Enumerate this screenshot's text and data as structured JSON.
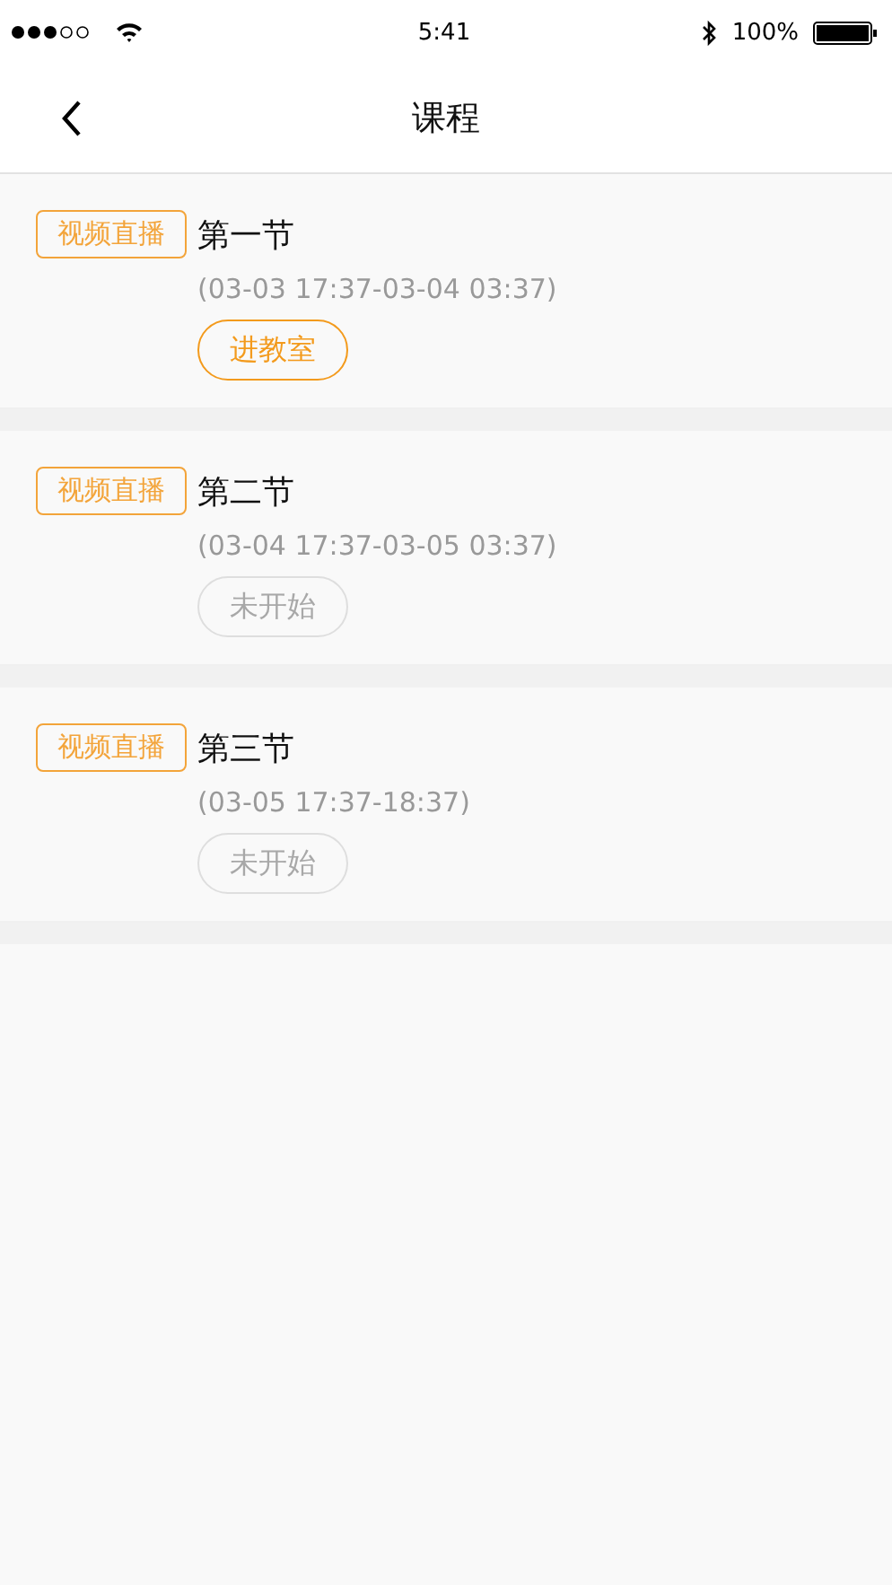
{
  "status_bar": {
    "time": "5:41",
    "battery": "100%"
  },
  "nav_bar": {
    "title": "课程"
  },
  "lessons": [
    {
      "tag": "视频直播",
      "title": "第一节",
      "time": "(03-03 17:37-03-04 03:37)",
      "button": {
        "label": "进教室",
        "disabled": false
      }
    },
    {
      "tag": "视频直播",
      "title": "第二节",
      "time": "(03-04 17:37-03-05 03:37)",
      "button": {
        "label": "未开始",
        "disabled": true
      }
    },
    {
      "tag": "视频直播",
      "title": "第三节",
      "time": "(03-05 17:37-18:37)",
      "button": {
        "label": "未开始",
        "disabled": true
      }
    }
  ]
}
